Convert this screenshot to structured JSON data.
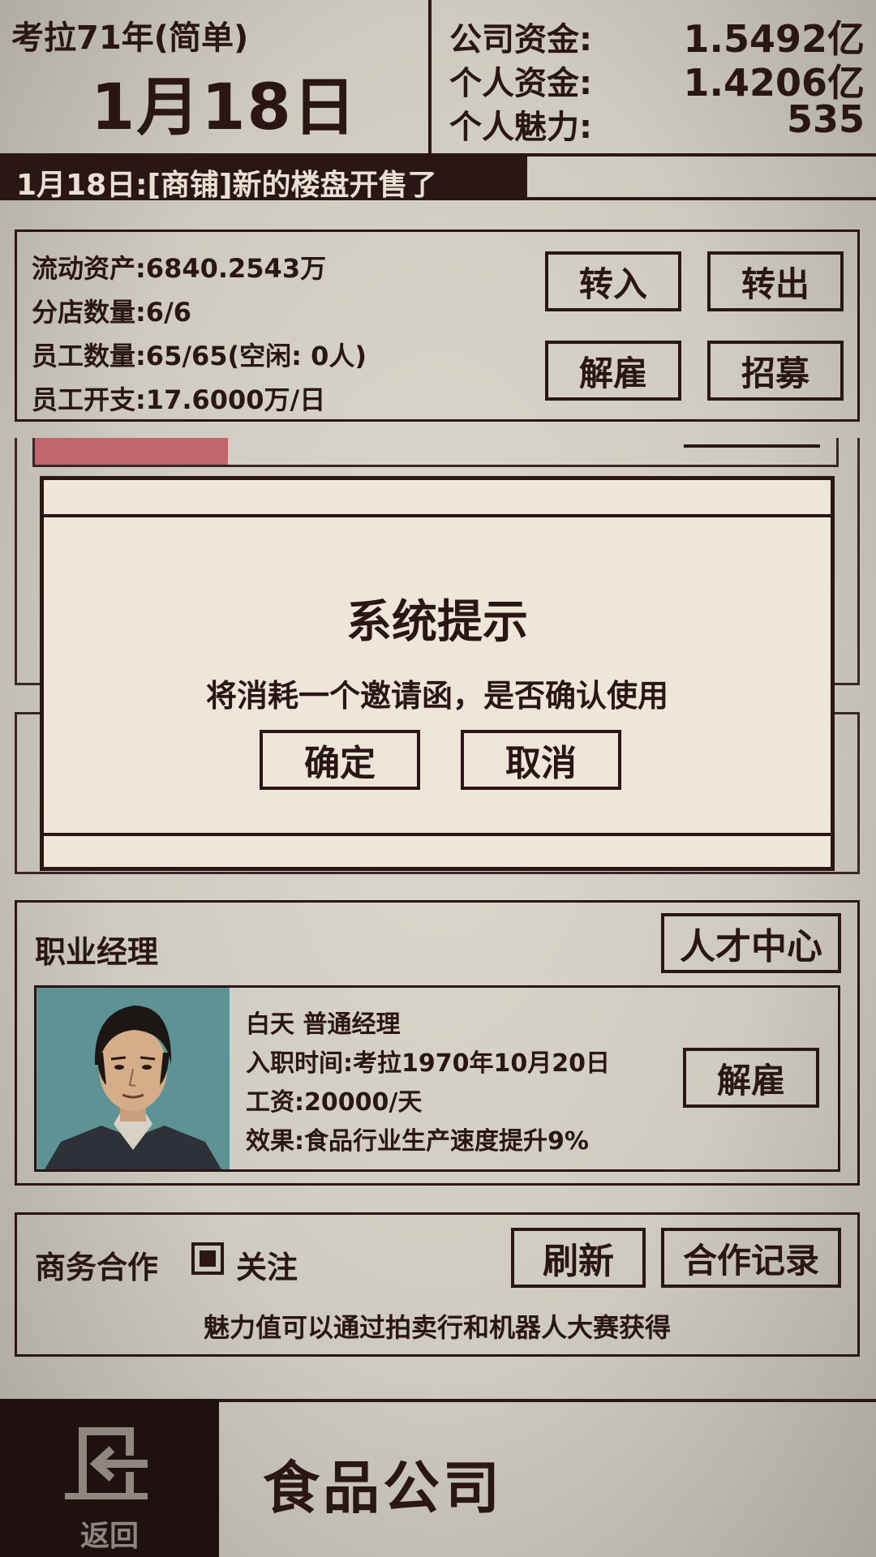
{
  "header": {
    "year_mode": "考拉71年(简单)",
    "date": "1月18日",
    "company_funds_label": "公司资金:",
    "company_funds_value": "1.5492亿",
    "personal_funds_label": "个人资金:",
    "personal_funds_value": "1.4206亿",
    "charm_label": "个人魅力:",
    "charm_value": "535"
  },
  "news": {
    "text": "1月18日:[商铺]新的楼盘开售了"
  },
  "stats": {
    "liquid_assets": "流动资产:6840.2543万",
    "branch_count": "分店数量:6/6",
    "employee_count": "员工数量:65/65(空闲: 0人)",
    "employee_cost": "员工开支:17.6000万/日",
    "transfer_in": "转入",
    "transfer_out": "转出",
    "fire": "解雇",
    "recruit": "招募"
  },
  "modal": {
    "title": "系统提示",
    "message": "将消耗一个邀请函，是否确认使用",
    "confirm": "确定",
    "cancel": "取消"
  },
  "manager": {
    "section_title": "职业经理",
    "talent_center": "人才中心",
    "name": "白天 普通经理",
    "hire_date": "入职时间:考拉1970年10月20日",
    "salary": "工资:20000/天",
    "effect": "效果:食品行业生产速度提升9%",
    "fire": "解雇"
  },
  "cooperation": {
    "title": "商务合作",
    "follow": "关注",
    "refresh": "刷新",
    "records": "合作记录",
    "tip": "魅力值可以通过拍卖行和机器人大赛获得"
  },
  "footer": {
    "back": "返回",
    "company_name": "食品公司"
  },
  "colors": {
    "ink": "#2a1614",
    "paper": "#ede6d9",
    "accent_red": "#c0666c",
    "portrait_bg": "#5e9396"
  }
}
